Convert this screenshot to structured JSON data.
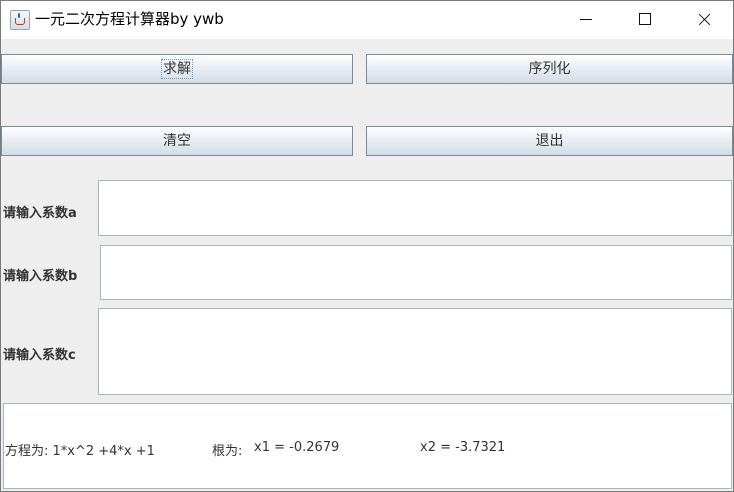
{
  "window": {
    "title": "一元二次方程计算器by ywb"
  },
  "buttons": {
    "solve": "求解",
    "serialize": "序列化",
    "clear": "清空",
    "exit": "退出"
  },
  "inputs": {
    "a": {
      "label": "请输入系数a",
      "value": ""
    },
    "b": {
      "label": "请输入系数b",
      "value": ""
    },
    "c": {
      "label": "请输入系数c",
      "value": ""
    }
  },
  "result": {
    "equation": "方程为: 1*x^2 +4*x +1",
    "roots_label": "根为:",
    "x1": "x1 = -0.2679",
    "x2": "x2 = -3.7321"
  }
}
